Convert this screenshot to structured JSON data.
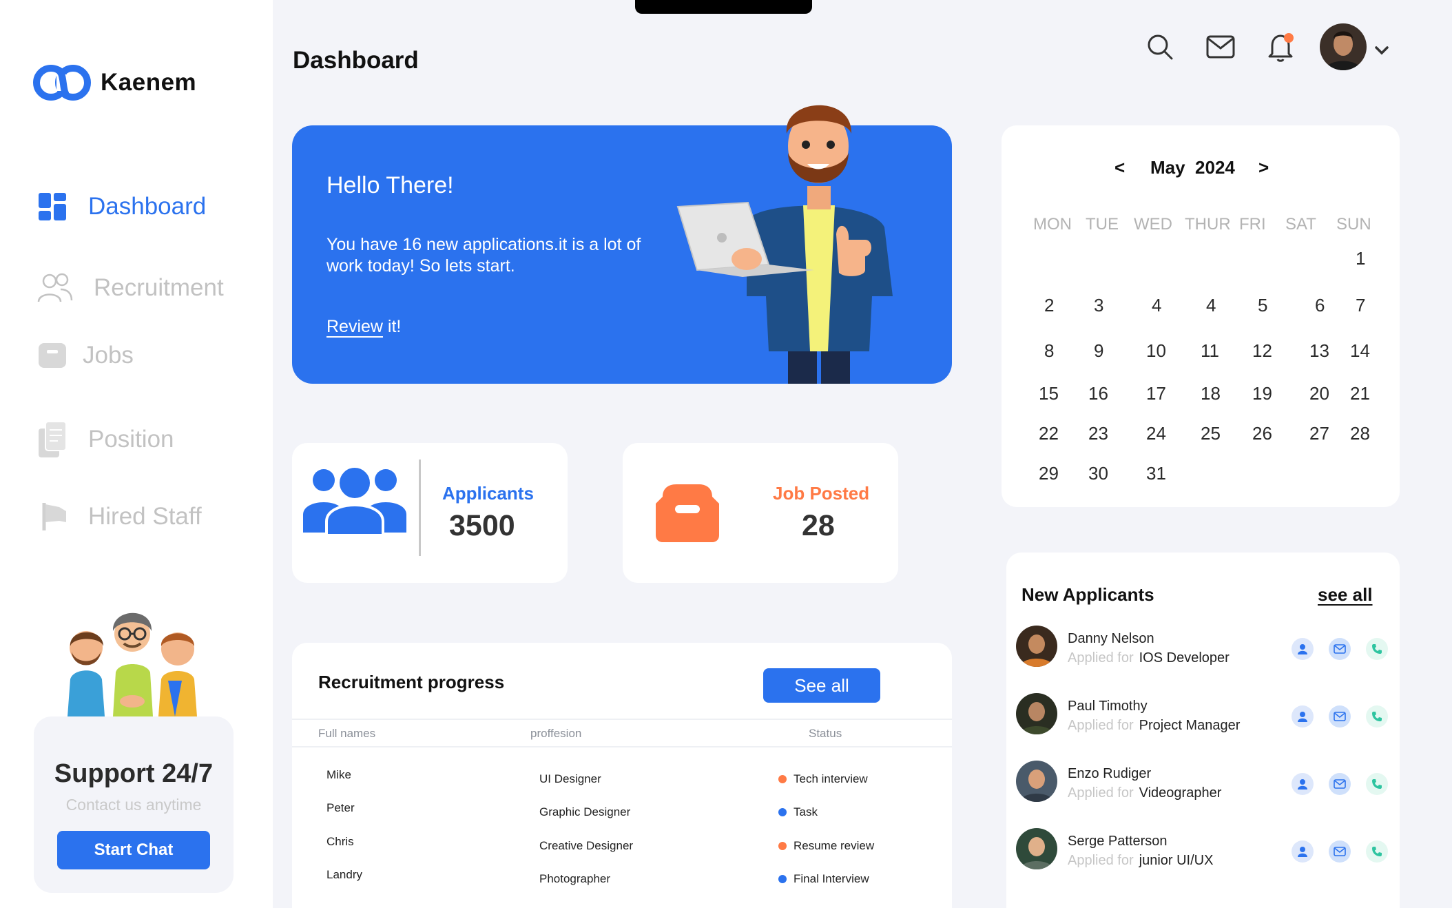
{
  "brand": {
    "name": "Kaenem",
    "accent": "#2b72ee",
    "orange": "#ff7a45"
  },
  "sidebar": {
    "items": [
      {
        "label": "Dashboard",
        "icon": "grid-icon"
      },
      {
        "label": "Recruitment",
        "icon": "users-icon"
      },
      {
        "label": "Jobs",
        "icon": "box-icon"
      },
      {
        "label": "Position",
        "icon": "documents-icon"
      },
      {
        "label": "Hired Staff",
        "icon": "flag-icon"
      }
    ],
    "support": {
      "title": "Support 24/7",
      "subtitle": "Contact us anytime",
      "button": "Start Chat"
    }
  },
  "header": {
    "title": "Dashboard",
    "icons": [
      "search-icon",
      "mail-icon",
      "bell-icon"
    ]
  },
  "hero": {
    "title": "Hello There!",
    "text": "You have 16 new applications.it is a lot of work today! So lets start.",
    "link": "Review",
    "link_suffix": " it!"
  },
  "stats": {
    "applicants": {
      "label": "Applicants",
      "value": "3500"
    },
    "jobs": {
      "label": "Job Posted",
      "value": "28"
    }
  },
  "progress": {
    "title": "Recruitment progress",
    "button": "See all",
    "columns": [
      "Full names",
      "proffesion",
      "Status"
    ],
    "rows": [
      {
        "name": "Mike",
        "profession": "UI Designer",
        "status": "Tech interview",
        "color": "#ff7a45"
      },
      {
        "name": "Peter",
        "profession": "Graphic Designer",
        "status": "Task",
        "color": "#2b72ee"
      },
      {
        "name": "Chris",
        "profession": "Creative Designer",
        "status": "Resume review",
        "color": "#ff7a45"
      },
      {
        "name": "Landry",
        "profession": "Photographer",
        "status": "Final Interview",
        "color": "#2b72ee"
      }
    ]
  },
  "calendar": {
    "prev": "<",
    "next": ">",
    "month": "May",
    "year": "2024",
    "days": [
      "MON",
      "TUE",
      "WED",
      "THUR",
      "FRI",
      "SAT",
      "SUN"
    ],
    "weeks": [
      [
        "",
        "",
        "",
        "",
        "",
        "",
        "1"
      ],
      [
        "2",
        "3",
        "4",
        "4",
        "5",
        "6",
        "7"
      ],
      [
        "8",
        "9",
        "10",
        "11",
        "12",
        "13",
        "14"
      ],
      [
        "15",
        "16",
        "17",
        "18",
        "19",
        "20",
        "21"
      ],
      [
        "22",
        "23",
        "24",
        "25",
        "26",
        "27",
        "28"
      ],
      [
        "29",
        "30",
        "31",
        "",
        "",
        "",
        ""
      ]
    ]
  },
  "new_applicants": {
    "title": "New Applicants",
    "see_all": "see all",
    "prefix": "Applied for",
    "items": [
      {
        "name": "Danny Nelson",
        "role": "IOS Developer"
      },
      {
        "name": "Paul Timothy",
        "role": "Project Manager"
      },
      {
        "name": "Enzo Rudiger",
        "role": "Videographer"
      },
      {
        "name": "Serge Patterson",
        "role": "junior UI/UX"
      }
    ]
  }
}
